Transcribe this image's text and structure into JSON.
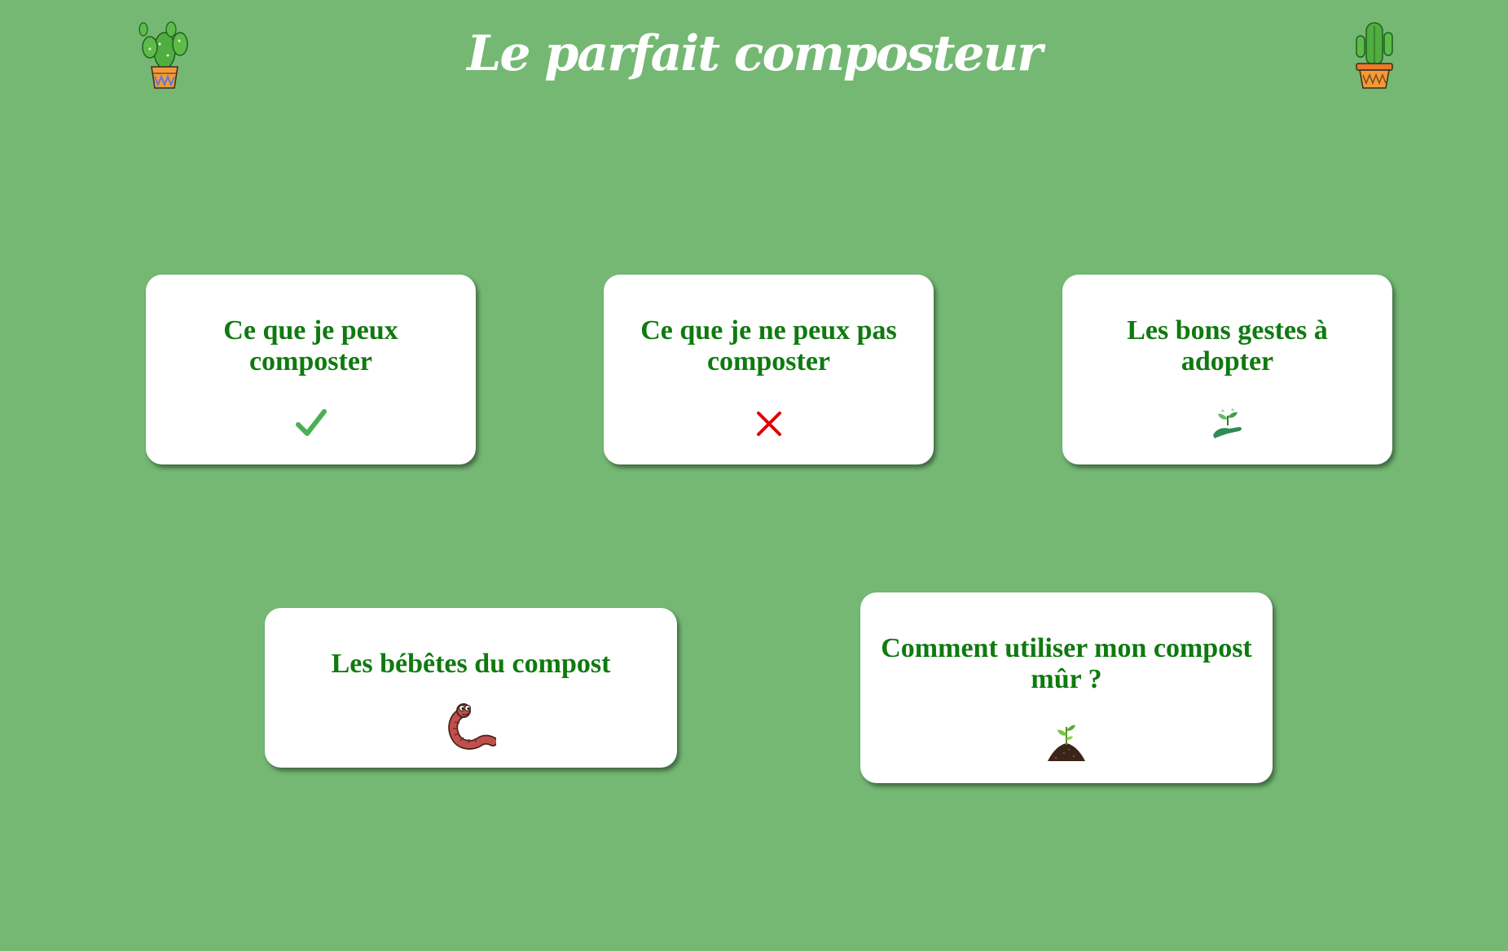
{
  "header": {
    "title": "Le parfait composteur",
    "left_icon": "cactus-pot-icon",
    "right_icon": "cactus-pot-icon"
  },
  "colors": {
    "background": "#74b874",
    "card_background": "#ffffff",
    "card_title": "#0f7a0f",
    "check": "#4caf50",
    "cross": "#e00000"
  },
  "cards": [
    {
      "title": "Ce que je peux composter",
      "icon": "checkmark-icon"
    },
    {
      "title": "Ce que je ne peux pas composter",
      "icon": "cross-icon"
    },
    {
      "title": "Les bons gestes à adopter",
      "icon": "hand-sprout-icon"
    },
    {
      "title": "Les bébêtes du compost",
      "icon": "worm-icon"
    },
    {
      "title": "Comment utiliser mon compost mûr ?",
      "icon": "soil-sprout-icon"
    }
  ]
}
